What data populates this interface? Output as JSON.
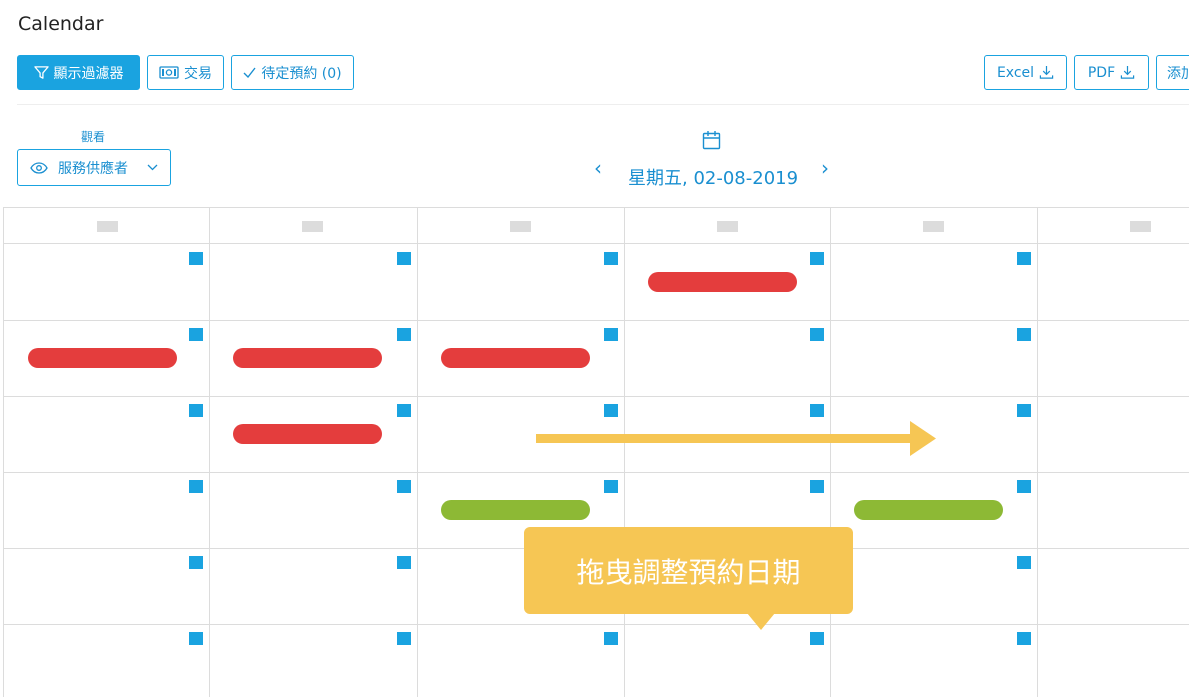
{
  "header": {
    "title": "Calendar"
  },
  "toolbar": {
    "filter_label": "顯示過濾器",
    "transactions_label": "交易",
    "pending_label": "待定預約 (0)",
    "excel_label": "Excel",
    "pdf_label": "PDF",
    "add_label": "添加"
  },
  "view": {
    "label": "觀看",
    "selected": "服務供應者"
  },
  "date_nav": {
    "current_date": "星期五, 02-08-2019"
  },
  "tooltip": {
    "text": "拖曳調整預約日期"
  },
  "colors": {
    "accent": "#1aa3e0",
    "appointment_red": "#e43d3d",
    "appointment_green": "#8db935",
    "highlight_yellow": "#f6c654"
  },
  "calendar": {
    "columns": 6,
    "rows": 6,
    "appointments": [
      {
        "row": 1,
        "col": 4,
        "color": "red"
      },
      {
        "row": 2,
        "col": 1,
        "color": "red"
      },
      {
        "row": 2,
        "col": 2,
        "color": "red"
      },
      {
        "row": 2,
        "col": 3,
        "color": "red"
      },
      {
        "row": 3,
        "col": 2,
        "color": "red"
      },
      {
        "row": 4,
        "col": 3,
        "color": "green"
      },
      {
        "row": 4,
        "col": 5,
        "color": "green"
      }
    ]
  },
  "icons": [
    "filter-icon",
    "money-icon",
    "check-icon",
    "download-icon",
    "eye-icon",
    "chevron-down-icon",
    "calendar-icon",
    "chevron-left-icon",
    "chevron-right-icon"
  ]
}
